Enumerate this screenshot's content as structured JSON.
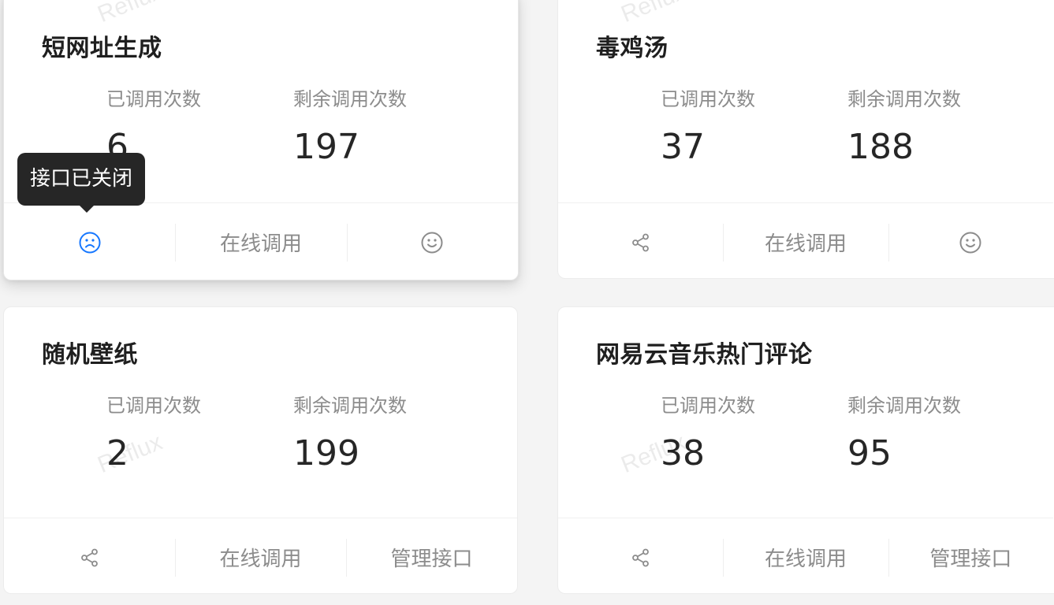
{
  "watermark": "Reflux",
  "accent_color": "#1677ff",
  "tooltip": {
    "text": "接口已关闭"
  },
  "cards": [
    {
      "title": "短网址生成",
      "used_label": "已调用次数",
      "used_value": "6",
      "remaining_label": "剩余调用次数",
      "remaining_value": "197",
      "actions": {
        "left_icon": "frown-icon",
        "middle_label": "在线调用",
        "right_icon": "smile-icon"
      }
    },
    {
      "title": "毒鸡汤",
      "used_label": "已调用次数",
      "used_value": "37",
      "remaining_label": "剩余调用次数",
      "remaining_value": "188",
      "actions": {
        "left_icon": "share-icon",
        "middle_label": "在线调用",
        "right_icon": "smile-icon"
      }
    },
    {
      "title": "随机壁纸",
      "used_label": "已调用次数",
      "used_value": "2",
      "remaining_label": "剩余调用次数",
      "remaining_value": "199",
      "actions": {
        "left_icon": "share-icon",
        "middle_label": "在线调用",
        "right_label": "管理接口"
      }
    },
    {
      "title": "网易云音乐热门评论",
      "used_label": "已调用次数",
      "used_value": "38",
      "remaining_label": "剩余调用次数",
      "remaining_value": "95",
      "actions": {
        "left_icon": "share-icon",
        "middle_label": "在线调用",
        "right_label": "管理接口"
      }
    }
  ]
}
